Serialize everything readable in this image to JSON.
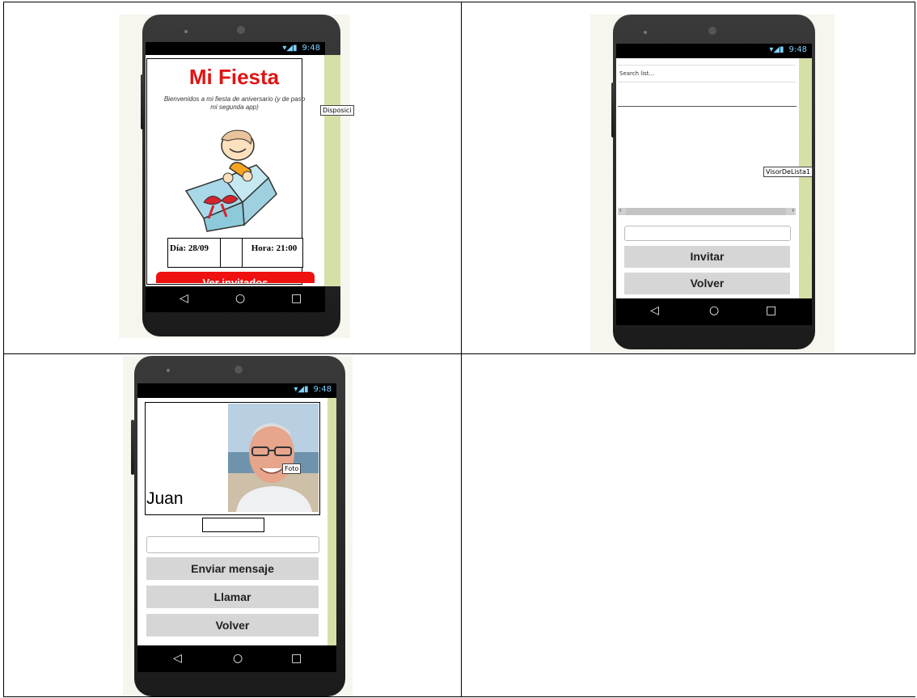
{
  "phones": {
    "status_time": "9:48",
    "nav_icons": [
      "back-triangle-icon",
      "home-circle-icon",
      "recents-square-icon"
    ]
  },
  "screen1": {
    "title": "Mi Fiesta",
    "subtitle": "Bienvenidos a mi fiesta de aniversario (y de paso mi segunda app)",
    "tag": "Disposici",
    "day_label": "Día: 28/09",
    "hour_label": "Hora: 21:00",
    "button": "Ver invitados",
    "image": "cartoon boy in gift box"
  },
  "screen2": {
    "search_placeholder": "Search list...",
    "tag": "VisorDeLista1",
    "invite_button": "Invitar",
    "back_button": "Volver"
  },
  "screen3": {
    "name": "Juan",
    "photo_tag": "Foto",
    "send_button": "Enviar mensaje",
    "call_button": "Llamar",
    "back_button": "Volver"
  }
}
